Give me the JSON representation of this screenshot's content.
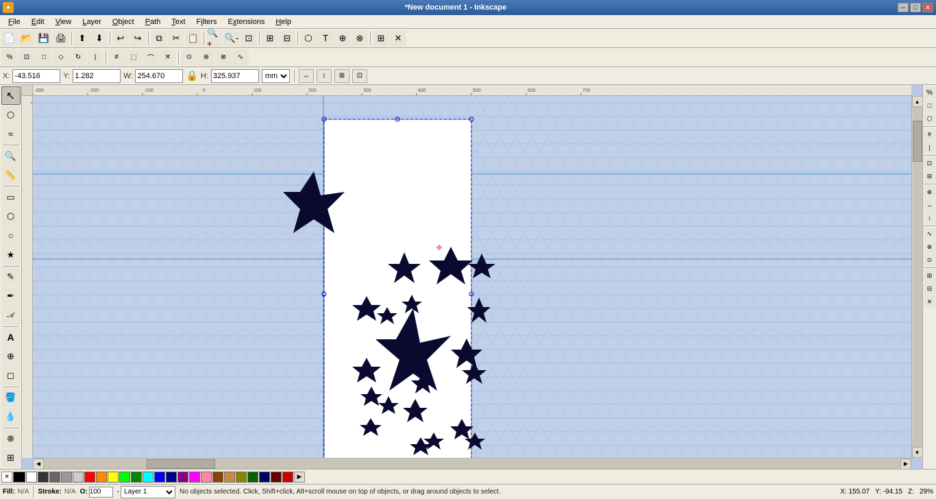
{
  "titlebar": {
    "title": "*New document 1 - Inkscape",
    "icon": "✦",
    "minimize_label": "─",
    "maximize_label": "□",
    "close_label": "✕"
  },
  "menubar": {
    "items": [
      {
        "label": "File",
        "underline": "F"
      },
      {
        "label": "Edit",
        "underline": "E"
      },
      {
        "label": "View",
        "underline": "V"
      },
      {
        "label": "Layer",
        "underline": "L"
      },
      {
        "label": "Object",
        "underline": "O"
      },
      {
        "label": "Path",
        "underline": "P"
      },
      {
        "label": "Text",
        "underline": "T"
      },
      {
        "label": "Filters",
        "underline": "i"
      },
      {
        "label": "Extensions",
        "underline": "x"
      },
      {
        "label": "Help",
        "underline": "H"
      }
    ]
  },
  "coordbar": {
    "x_label": "X:",
    "x_value": "-43.516",
    "y_label": "Y:",
    "y_value": "1.282",
    "w_label": "W:",
    "w_value": "254.670",
    "h_label": "H:",
    "h_value": "325.937",
    "units": "mm"
  },
  "left_tools": [
    {
      "icon": "↖",
      "name": "select-tool",
      "title": "Select"
    },
    {
      "icon": "⬡",
      "name": "node-tool",
      "title": "Node"
    },
    {
      "icon": "↺",
      "name": "tweak-tool",
      "title": "Tweak"
    },
    {
      "icon": "🔍",
      "name": "zoom-tool",
      "title": "Zoom"
    },
    {
      "icon": "📐",
      "name": "measure-tool",
      "title": "Measure"
    },
    {
      "icon": "▭",
      "name": "rect-tool",
      "title": "Rectangle"
    },
    {
      "icon": "⬡",
      "name": "3d-box-tool",
      "title": "3D Box"
    },
    {
      "icon": "○",
      "name": "ellipse-tool",
      "title": "Ellipse"
    },
    {
      "icon": "★",
      "name": "star-tool",
      "title": "Star"
    },
    {
      "icon": "✎",
      "name": "pencil-tool",
      "title": "Pencil"
    },
    {
      "icon": "✒",
      "name": "pen-tool",
      "title": "Pen"
    },
    {
      "icon": "𝒜",
      "name": "calligraphy-tool",
      "title": "Calligraphy"
    },
    {
      "icon": "A",
      "name": "text-tool",
      "title": "Text"
    },
    {
      "icon": "⊕",
      "name": "spray-tool",
      "title": "Spray"
    },
    {
      "icon": "◻",
      "name": "eraser-tool",
      "title": "Eraser"
    },
    {
      "icon": "🪣",
      "name": "fill-tool",
      "title": "Fill"
    },
    {
      "icon": "⊸",
      "name": "dropper-tool",
      "title": "Dropper"
    },
    {
      "icon": "⊗",
      "name": "connector-tool",
      "title": "Connector"
    },
    {
      "icon": "⊞",
      "name": "gradient-tool",
      "title": "Gradient"
    }
  ],
  "statusbar": {
    "fill_label": "Fill:",
    "fill_value": "N/A",
    "stroke_label": "Stroke:",
    "stroke_value": "N/A",
    "opacity_label": "O:",
    "opacity_value": "100",
    "layer_label": "Layer 1",
    "status_msg": "No objects selected. Click, Shift+click, Alt+scroll mouse on top of objects, or drag around objects to select.",
    "x_coord": "X: 155.07",
    "y_coord": "Y: -94.15",
    "zoom": "29%"
  }
}
